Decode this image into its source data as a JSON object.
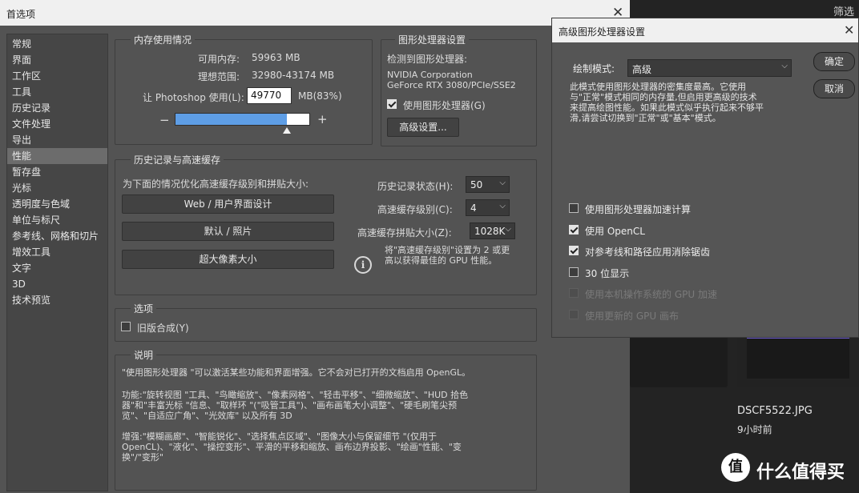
{
  "background": {
    "filter_label": "筛选",
    "file_name": "DSCF5522.JPG",
    "file_time": "9小时前",
    "brand_logo_glyph": "值",
    "brand_text": "什么值得买"
  },
  "dialog": {
    "title": "首选项",
    "close_glyph": "✕"
  },
  "sidebar": {
    "items": [
      {
        "label": "常规"
      },
      {
        "label": "界面"
      },
      {
        "label": "工作区"
      },
      {
        "label": "工具"
      },
      {
        "label": "历史记录"
      },
      {
        "label": "文件处理"
      },
      {
        "label": "导出"
      },
      {
        "label": "性能",
        "selected": true
      },
      {
        "label": "暂存盘"
      },
      {
        "label": "光标"
      },
      {
        "label": "透明度与色域"
      },
      {
        "label": "单位与标尺"
      },
      {
        "label": "参考线、网格和切片"
      },
      {
        "label": "增效工具"
      },
      {
        "label": "文字"
      },
      {
        "label": "3D"
      },
      {
        "label": "技术预览"
      }
    ]
  },
  "memory": {
    "title": "内存使用情况",
    "available_label": "可用内存:",
    "available_value": "59963 MB",
    "ideal_label": "理想范围:",
    "ideal_value": "32980-43174 MB",
    "let_label": "让 Photoshop 使用(L):",
    "let_value": "49770",
    "let_unit": "MB(83%)",
    "minus": "−",
    "plus": "+",
    "slider_fraction": 0.83
  },
  "gpu": {
    "title": "图形处理器设置",
    "detected_label": "检测到图形处理器:",
    "vendor": "NVIDIA Corporation",
    "model": "GeForce RTX 3080/PCIe/SSE2",
    "use_gpu_label": "使用图形处理器(G)",
    "use_gpu_checked": true,
    "advanced_button": "高级设置..."
  },
  "history": {
    "title": "历史记录与高速缓存",
    "optimize_label": "为下面的情况优化高速缓存级别和拼贴大小:",
    "btn_web": "Web / 用户界面设计",
    "btn_default": "默认 / 照片",
    "btn_huge": "超大像素大小",
    "states_label": "历史记录状态(H):",
    "states_value": "50",
    "cache_label": "高速缓存级别(C):",
    "cache_value": "4",
    "tile_label": "高速缓存拼贴大小(Z):",
    "tile_value": "1028K",
    "info_line1": "将\"高速缓存级别\"设置为 2 或更",
    "info_line2": "高以获得最佳的 GPU 性能。",
    "info_icon": "i"
  },
  "options": {
    "title": "选项",
    "legacy_label": "旧版合成(Y)",
    "legacy_checked": false
  },
  "description": {
    "title": "说明",
    "p1": "\"使用图形处理器 \"可以激活某些功能和界面增强。它不会对已打开的文档启用 OpenGL。",
    "p2a": "功能:\"旋转视图 \"工具、\"鸟瞰缩放\"、\"像素网格\"、\"轻击平移\"、\"细微缩放\"、\"HUD 拾色",
    "p2b": "器\"和\"丰富光标 \"信息、\"取样环 \"(\"吸管工具\")、\"画布画笔大小调整\"、\"硬毛刷笔尖预",
    "p2c": "览\"、\"自适应广角\"、\"光效库\" 以及所有 3D",
    "p3a": "增强:\"模糊画廊\"、\"智能锐化\"、\"选择焦点区域\"、\"图像大小与保留细节 \"(仅用于",
    "p3b": "OpenCL)、\"液化\"、\"操控变形\"、平滑的平移和缩放、画布边界投影、\"绘画\"性能、\"变",
    "p3c": "换\"/\"变形\""
  },
  "advanced": {
    "title": "高级图形处理器设置",
    "close_glyph": "✕",
    "mode_label": "绘制模式:",
    "mode_value": "高级",
    "ok": "确定",
    "cancel": "取消",
    "desc1": "此模式使用图形处理器的密集度最高。它使用",
    "desc2": "与\"正常\"模式相同的内存量,但启用更高级的技术",
    "desc3": "来提高绘图性能。如果此模式似乎执行起来不够平",
    "desc4": "滑,请尝试切换到\"正常\"或\"基本\"模式。",
    "options": [
      {
        "label": "使用图形处理器加速计算",
        "checked": false,
        "disabled": false
      },
      {
        "label": "使用 OpenCL",
        "checked": true,
        "disabled": false
      },
      {
        "label": "对参考线和路径应用消除锯齿",
        "checked": true,
        "disabled": false
      },
      {
        "label": "30 位显示",
        "checked": false,
        "disabled": false
      },
      {
        "label": "使用本机操作系统的 GPU 加速",
        "checked": false,
        "disabled": true
      },
      {
        "label": "使用更新的 GPU 画布",
        "checked": false,
        "disabled": true
      }
    ]
  }
}
